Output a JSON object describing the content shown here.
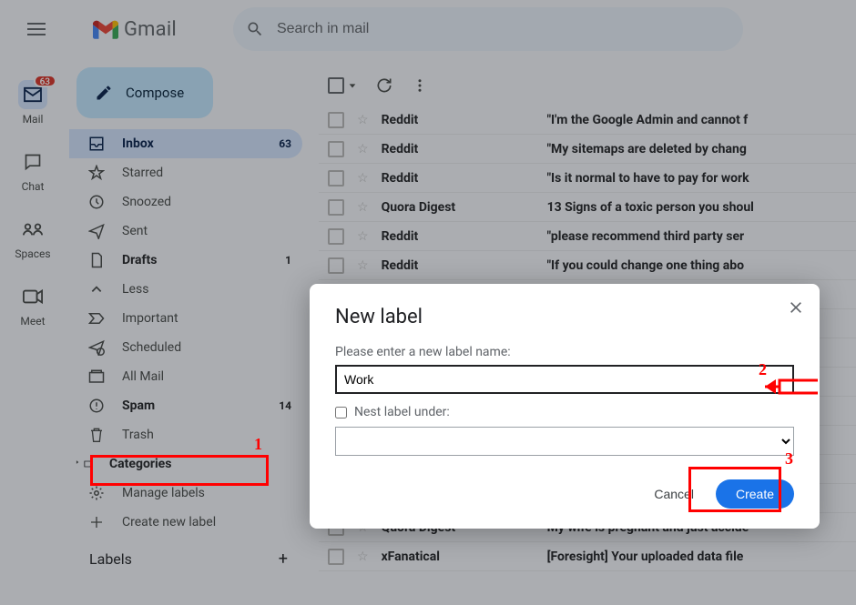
{
  "header": {
    "app_name": "Gmail",
    "search_placeholder": "Search in mail"
  },
  "rail": {
    "items": [
      {
        "key": "mail",
        "label": "Mail",
        "badge": "63"
      },
      {
        "key": "chat",
        "label": "Chat"
      },
      {
        "key": "spaces",
        "label": "Spaces"
      },
      {
        "key": "meet",
        "label": "Meet"
      }
    ]
  },
  "sidebar": {
    "compose_label": "Compose",
    "items": [
      {
        "key": "inbox",
        "label": "Inbox",
        "count": "63",
        "selected": true,
        "bold": true
      },
      {
        "key": "starred",
        "label": "Starred"
      },
      {
        "key": "snoozed",
        "label": "Snoozed"
      },
      {
        "key": "sent",
        "label": "Sent"
      },
      {
        "key": "drafts",
        "label": "Drafts",
        "count": "1",
        "bold": true
      },
      {
        "key": "less",
        "label": "Less"
      },
      {
        "key": "important",
        "label": "Important"
      },
      {
        "key": "scheduled",
        "label": "Scheduled"
      },
      {
        "key": "allmail",
        "label": "All Mail"
      },
      {
        "key": "spam",
        "label": "Spam",
        "count": "14",
        "bold": true
      },
      {
        "key": "trash",
        "label": "Trash"
      },
      {
        "key": "categories",
        "label": "Categories",
        "bold": true
      },
      {
        "key": "manage",
        "label": "Manage labels"
      },
      {
        "key": "create",
        "label": "Create new label"
      }
    ],
    "labels_heading": "Labels"
  },
  "mail": {
    "rows": [
      {
        "sender": "Reddit",
        "subject": "\"I'm the Google Admin and cannot f"
      },
      {
        "sender": "Reddit",
        "subject": "\"My sitemaps are deleted by chang"
      },
      {
        "sender": "Reddit",
        "subject": "\"Is it normal to have to pay for work"
      },
      {
        "sender": "Quora Digest",
        "subject": "13 Signs of a toxic person you shoul"
      },
      {
        "sender": "Reddit",
        "subject": "\"please recommend third party ser"
      },
      {
        "sender": "Reddit",
        "subject": "\"If you could change one thing abo"
      },
      {
        "sender": "",
        "subject": "a re"
      },
      {
        "sender": "",
        "subject": "sleep"
      },
      {
        "sender": "",
        "subject": "s of t"
      },
      {
        "sender": "",
        "subject": "a file"
      },
      {
        "sender": "",
        "subject": "e priv"
      },
      {
        "sender": "",
        "subject": "s a wa"
      },
      {
        "sender": "",
        "subject": "ut top"
      },
      {
        "sender": "",
        "subject": "k thi"
      },
      {
        "sender": "Quora Digest",
        "subject": "My wife is pregnant and just accide"
      },
      {
        "sender": "xFanatical",
        "subject": "[Foresight] Your uploaded data file"
      }
    ]
  },
  "modal": {
    "title": "New label",
    "prompt": "Please enter a new label name:",
    "value": "Work",
    "nest_label": "Nest label under:",
    "cancel": "Cancel",
    "create": "Create"
  },
  "annotations": {
    "a1": "1",
    "a2": "2",
    "a3": "3"
  }
}
